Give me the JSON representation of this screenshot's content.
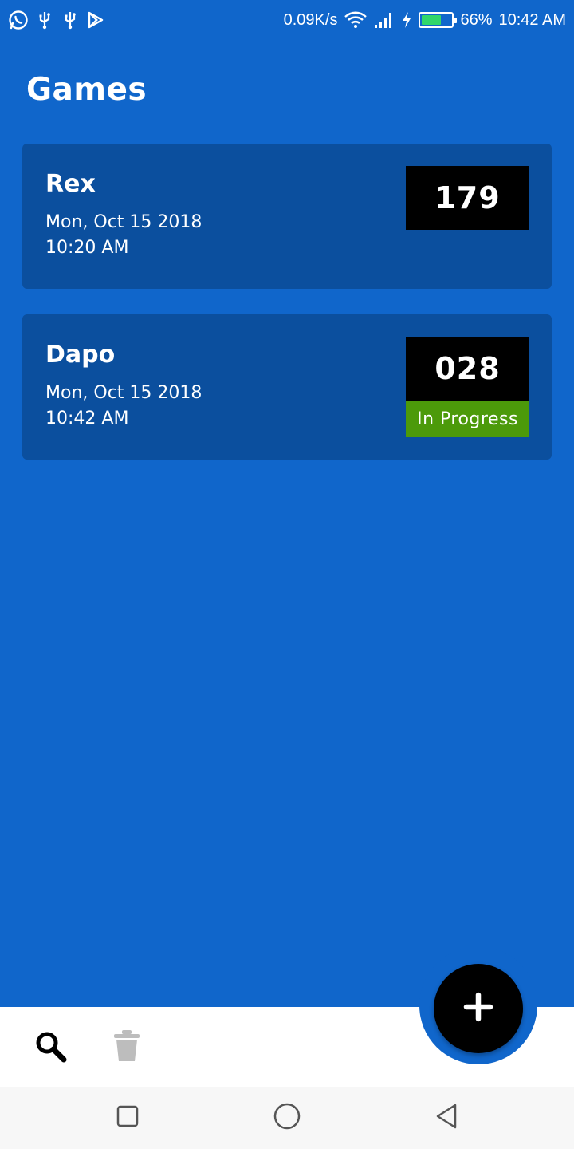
{
  "status_bar": {
    "net_speed": "0.09K/s",
    "battery_percent": "66%",
    "battery_level": 0.66,
    "time": "10:42 AM",
    "battery_color": "#31d66a",
    "left_icons": [
      "whatsapp-icon",
      "usb-icon",
      "usb-icon",
      "play-store-icon"
    ],
    "right_icons": [
      "wifi-icon",
      "signal-icon",
      "charging-icon",
      "battery-icon"
    ]
  },
  "header": {
    "title": "Games"
  },
  "games": [
    {
      "name": "Rex",
      "date": "Mon, Oct 15 2018",
      "time": "10:20 AM",
      "score": "179",
      "status": ""
    },
    {
      "name": "Dapo",
      "date": "Mon, Oct 15 2018",
      "time": "10:42 AM",
      "score": "028",
      "status": "In Progress"
    }
  ],
  "bottom_bar": {
    "icons": [
      "search-icon",
      "trash-icon"
    ],
    "fab_icon": "plus-icon"
  },
  "system_nav": {
    "icons": [
      "recents-square-icon",
      "home-circle-icon",
      "back-triangle-icon"
    ]
  },
  "colors": {
    "background": "#1066cb",
    "card": "#0b4f9e",
    "score_box": "#000000",
    "in_progress": "#4c9a0a",
    "fab": "#000000"
  }
}
